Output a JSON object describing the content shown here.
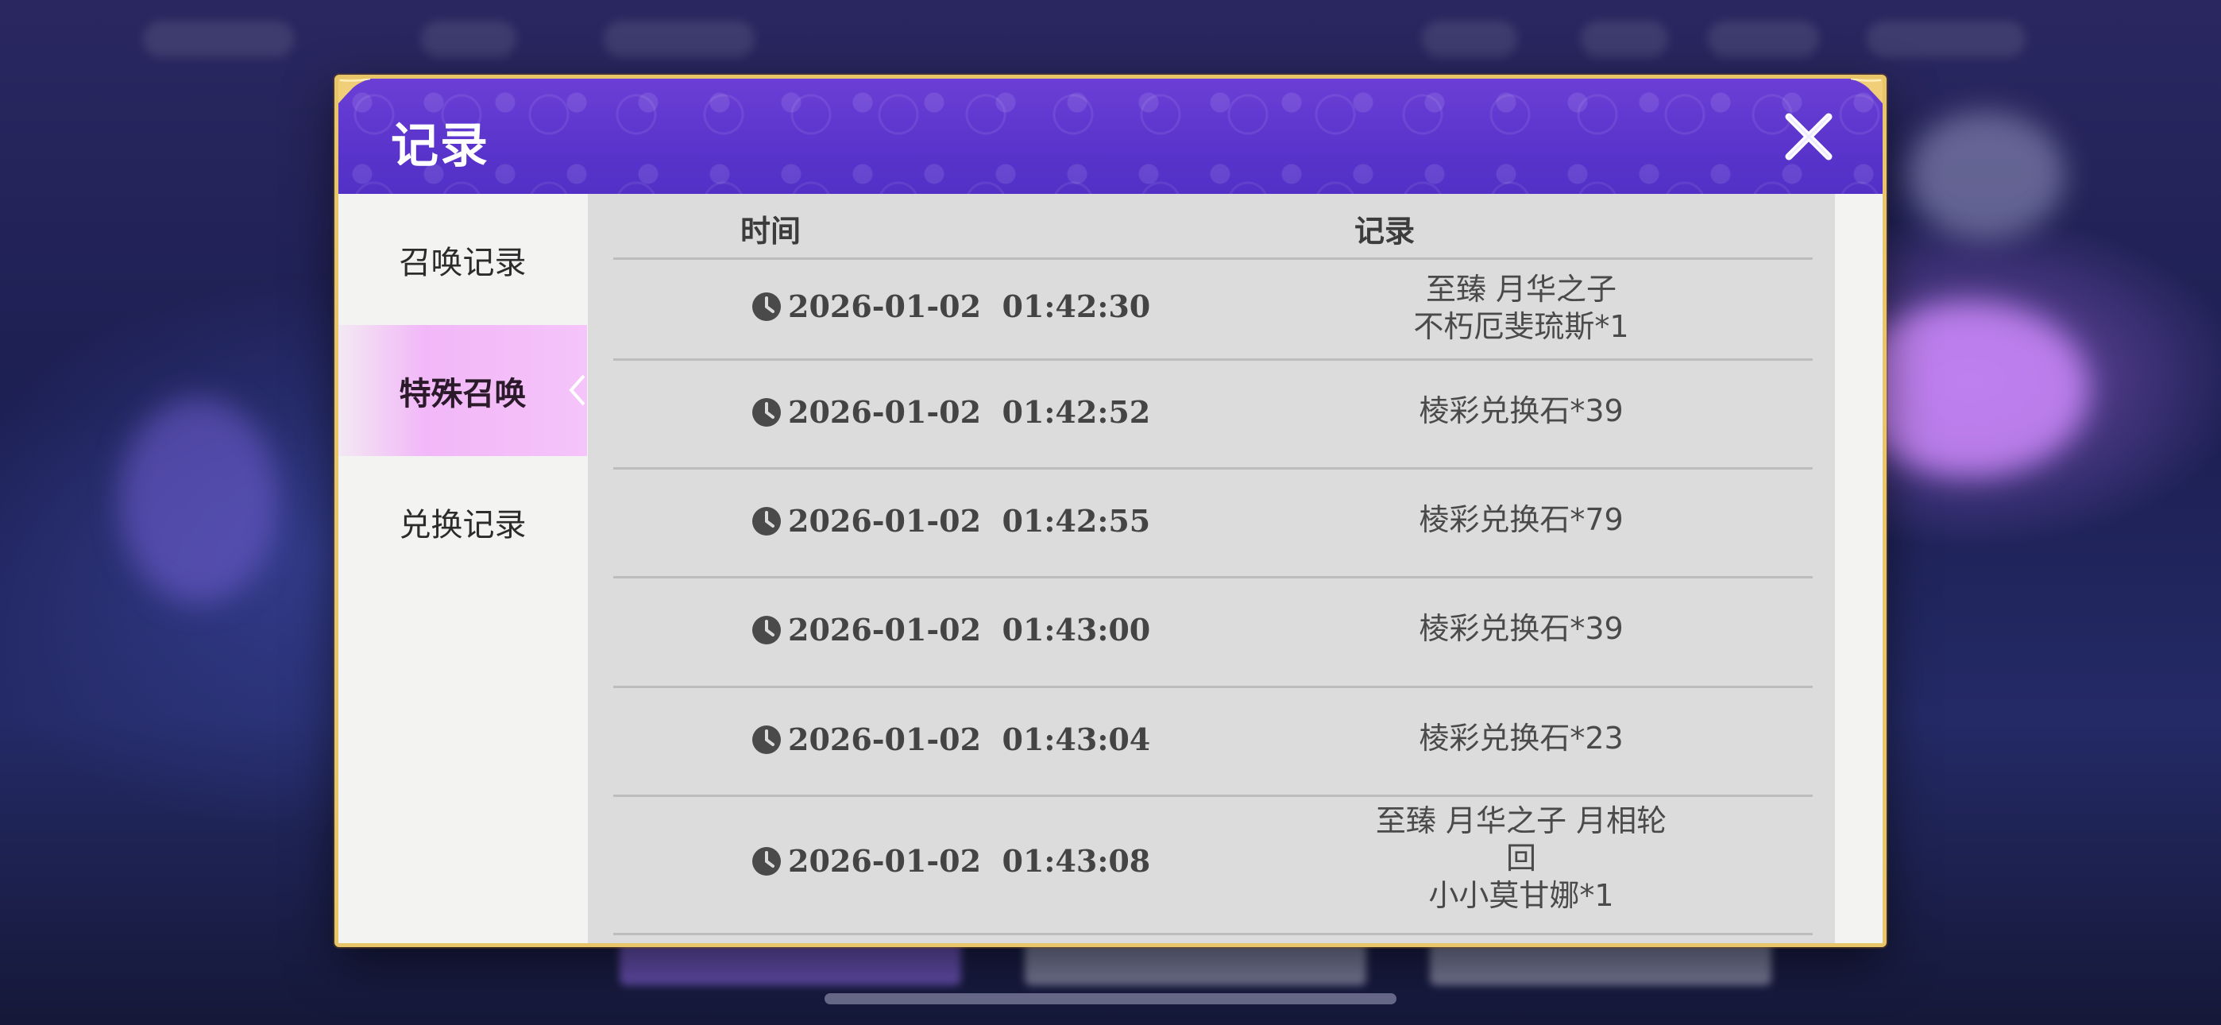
{
  "dialog": {
    "title": "记录",
    "close_icon": "close-icon"
  },
  "sidebar": {
    "items": [
      {
        "label": "召唤记录",
        "active": false
      },
      {
        "label": "特殊召唤",
        "active": true
      },
      {
        "label": "兑换记录",
        "active": false
      }
    ]
  },
  "table": {
    "columns": [
      "时间",
      "记录"
    ],
    "rows": [
      {
        "time": "2026-01-02  01:42:30",
        "record": "至臻  月华之子\n不朽厄斐琉斯*1"
      },
      {
        "time": "2026-01-02  01:42:52",
        "record": "棱彩兑换石*39"
      },
      {
        "time": "2026-01-02  01:42:55",
        "record": "棱彩兑换石*79"
      },
      {
        "time": "2026-01-02  01:43:00",
        "record": "棱彩兑换石*39"
      },
      {
        "time": "2026-01-02  01:43:04",
        "record": "棱彩兑换石*23"
      },
      {
        "time": "2026-01-02  01:43:08",
        "record": "至臻  月华之子  月相轮\n回\n小小莫甘娜*1"
      }
    ]
  },
  "colors": {
    "header_purple": "#5a34cc",
    "frame_gold": "#e9c56a",
    "active_tab_pink": "#f2b7f8",
    "table_bg": "#dcdcdc"
  }
}
